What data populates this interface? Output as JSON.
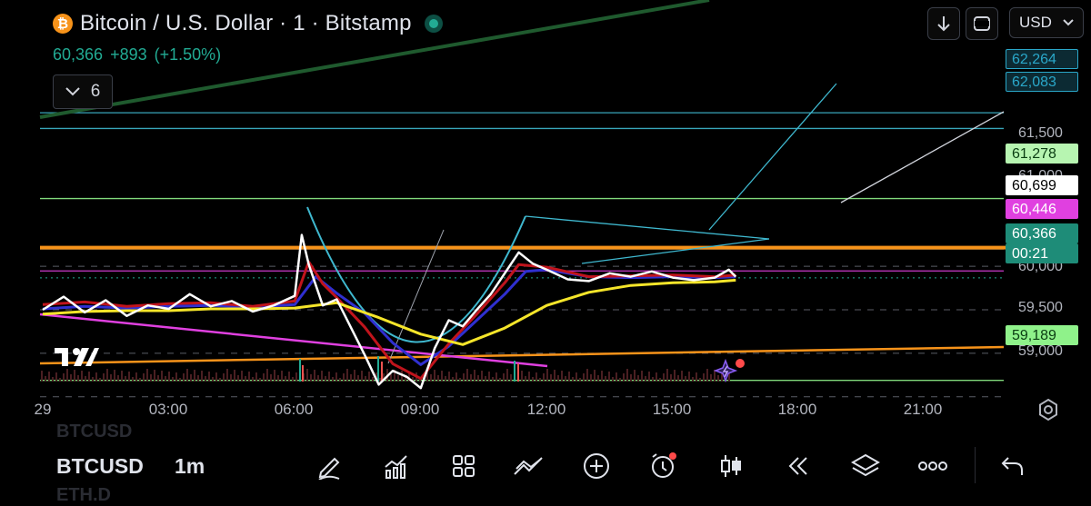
{
  "header": {
    "title": "Bitcoin / U.S. Dollar · 1 · Bitstamp",
    "logo_glyph": "₿",
    "last_price": "60,366",
    "change": "+893",
    "change_pct": "(+1.50%)",
    "indicator_count": "6",
    "currency": "USD"
  },
  "price_axis_labels": [
    "61,500",
    "61,000",
    "60,000",
    "59,500",
    "59,000"
  ],
  "price_badges": [
    {
      "value": "62,264",
      "bg": "#0c2a33",
      "fg": "#2aa7c9",
      "border": "#2aa7c9"
    },
    {
      "value": "62,083",
      "bg": "#0c2a33",
      "fg": "#2aa7c9",
      "border": "#2aa7c9"
    },
    {
      "value": "61,278",
      "bg": "#b7f5b1",
      "fg": "#0a3d12",
      "border": "#b7f5b1"
    },
    {
      "value": "60,699",
      "bg": "#ffffff",
      "fg": "#000000",
      "border": "#ffffff"
    },
    {
      "value": "60,446",
      "bg": "#e040e0",
      "fg": "#ffffff",
      "border": "#e040e0"
    },
    {
      "value": "60,366",
      "bg": "#1e8c78",
      "fg": "#ffffff",
      "border": "#1e8c78"
    },
    {
      "value": "00:21",
      "bg": "#1e8c78",
      "fg": "#ffffff",
      "border": "#1e8c78"
    },
    {
      "value": "59,189",
      "bg": "#8ff28a",
      "fg": "#0a3d12",
      "border": "#8ff28a"
    }
  ],
  "time_axis_labels": [
    "29",
    "03:00",
    "06:00",
    "09:00",
    "12:00",
    "15:00",
    "18:00",
    "21:00"
  ],
  "bottom": {
    "symbol": "BTCUSD",
    "timeframe": "1m",
    "ghost_above": "BTCUSD",
    "ghost_below": "ETH.D"
  },
  "colors": {
    "up": "#22ab94",
    "ema_white": "#ffffff",
    "ema_yellow": "#f5e52a",
    "ema_red": "#c0141c",
    "ema_blue": "#2f2fd0",
    "cyan": "#3fb8cf",
    "orange": "#f7931a",
    "magenta": "#e040e0",
    "green_line": "#8ff28a"
  },
  "chart_data": {
    "type": "line",
    "symbol": "BTCUSD",
    "interval": "1m",
    "exchange": "Bitstamp",
    "x_labels": [
      "29",
      "03:00",
      "06:00",
      "09:00",
      "12:00",
      "15:00",
      "18:00",
      "21:00"
    ],
    "ylim": [
      58900,
      62350
    ],
    "y_ticks": [
      59000,
      59500,
      60000,
      60500,
      61000,
      61500
    ],
    "series": [
      {
        "color": "#ffffff",
        "x": [
          "00:00",
          "00:30",
          "01:00",
          "01:30",
          "02:00",
          "02:30",
          "03:00",
          "03:30",
          "04:00",
          "04:30",
          "05:00",
          "05:30",
          "06:00",
          "06:10",
          "06:20",
          "06:40",
          "07:00",
          "07:20",
          "07:40",
          "08:00",
          "08:20",
          "08:40",
          "09:00",
          "09:20",
          "09:40",
          "10:00",
          "10:20",
          "10:40",
          "11:00",
          "11:20",
          "11:40",
          "12:00",
          "12:30",
          "13:00",
          "13:30",
          "14:00",
          "14:30",
          "15:00",
          "15:30",
          "16:00",
          "16:20",
          "16:30"
        ],
        "values": [
          60000,
          60150,
          59970,
          60110,
          59930,
          60050,
          60010,
          60180,
          60040,
          60100,
          59980,
          60050,
          60160,
          60860,
          60520,
          60050,
          60120,
          59800,
          59480,
          59140,
          59300,
          59230,
          59100,
          59560,
          59880,
          59810,
          60000,
          60180,
          60420,
          60660,
          60530,
          60460,
          60350,
          60330,
          60420,
          60380,
          60440,
          60370,
          60340,
          60370,
          60460,
          60380
        ]
      },
      {
        "color": "#c0141c",
        "x": [
          "00:00",
          "01:00",
          "02:00",
          "03:00",
          "04:00",
          "05:00",
          "06:00",
          "06:20",
          "06:40",
          "07:00",
          "07:40",
          "08:20",
          "09:00",
          "09:40",
          "10:20",
          "11:00",
          "11:20",
          "12:00",
          "13:00",
          "14:00",
          "15:00",
          "16:00",
          "16:30"
        ],
        "values": [
          60060,
          60090,
          60040,
          60070,
          60080,
          60040,
          60100,
          60550,
          60300,
          60140,
          59800,
          59380,
          59210,
          59610,
          59950,
          60310,
          60520,
          60490,
          60380,
          60390,
          60400,
          60380,
          60400
        ]
      },
      {
        "color": "#2f2fd0",
        "x": [
          "00:00",
          "01:00",
          "02:00",
          "03:00",
          "04:00",
          "05:00",
          "06:00",
          "06:30",
          "07:00",
          "07:40",
          "08:20",
          "09:00",
          "09:40",
          "10:20",
          "11:00",
          "11:30",
          "12:00",
          "13:00",
          "14:00",
          "15:00",
          "16:00",
          "16:30"
        ],
        "values": [
          60010,
          60040,
          60020,
          60040,
          60050,
          60030,
          60060,
          60380,
          60190,
          59960,
          59620,
          59370,
          59580,
          59880,
          60180,
          60440,
          60460,
          60380,
          60370,
          60380,
          60370,
          60380
        ]
      },
      {
        "color": "#f5e52a",
        "x": [
          "00:00",
          "01:00",
          "02:00",
          "03:00",
          "04:00",
          "05:00",
          "06:00",
          "07:00",
          "08:00",
          "09:00",
          "10:00",
          "11:00",
          "12:00",
          "13:00",
          "14:00",
          "15:00",
          "16:00",
          "16:30"
        ],
        "values": [
          59950,
          59980,
          59990,
          59990,
          60010,
          60010,
          60020,
          60080,
          59910,
          59720,
          59600,
          59790,
          60050,
          60200,
          60280,
          60310,
          60320,
          60340
        ]
      }
    ],
    "horizontal_levels": [
      62264,
      62083,
      61278,
      60699,
      60446,
      59189
    ]
  }
}
